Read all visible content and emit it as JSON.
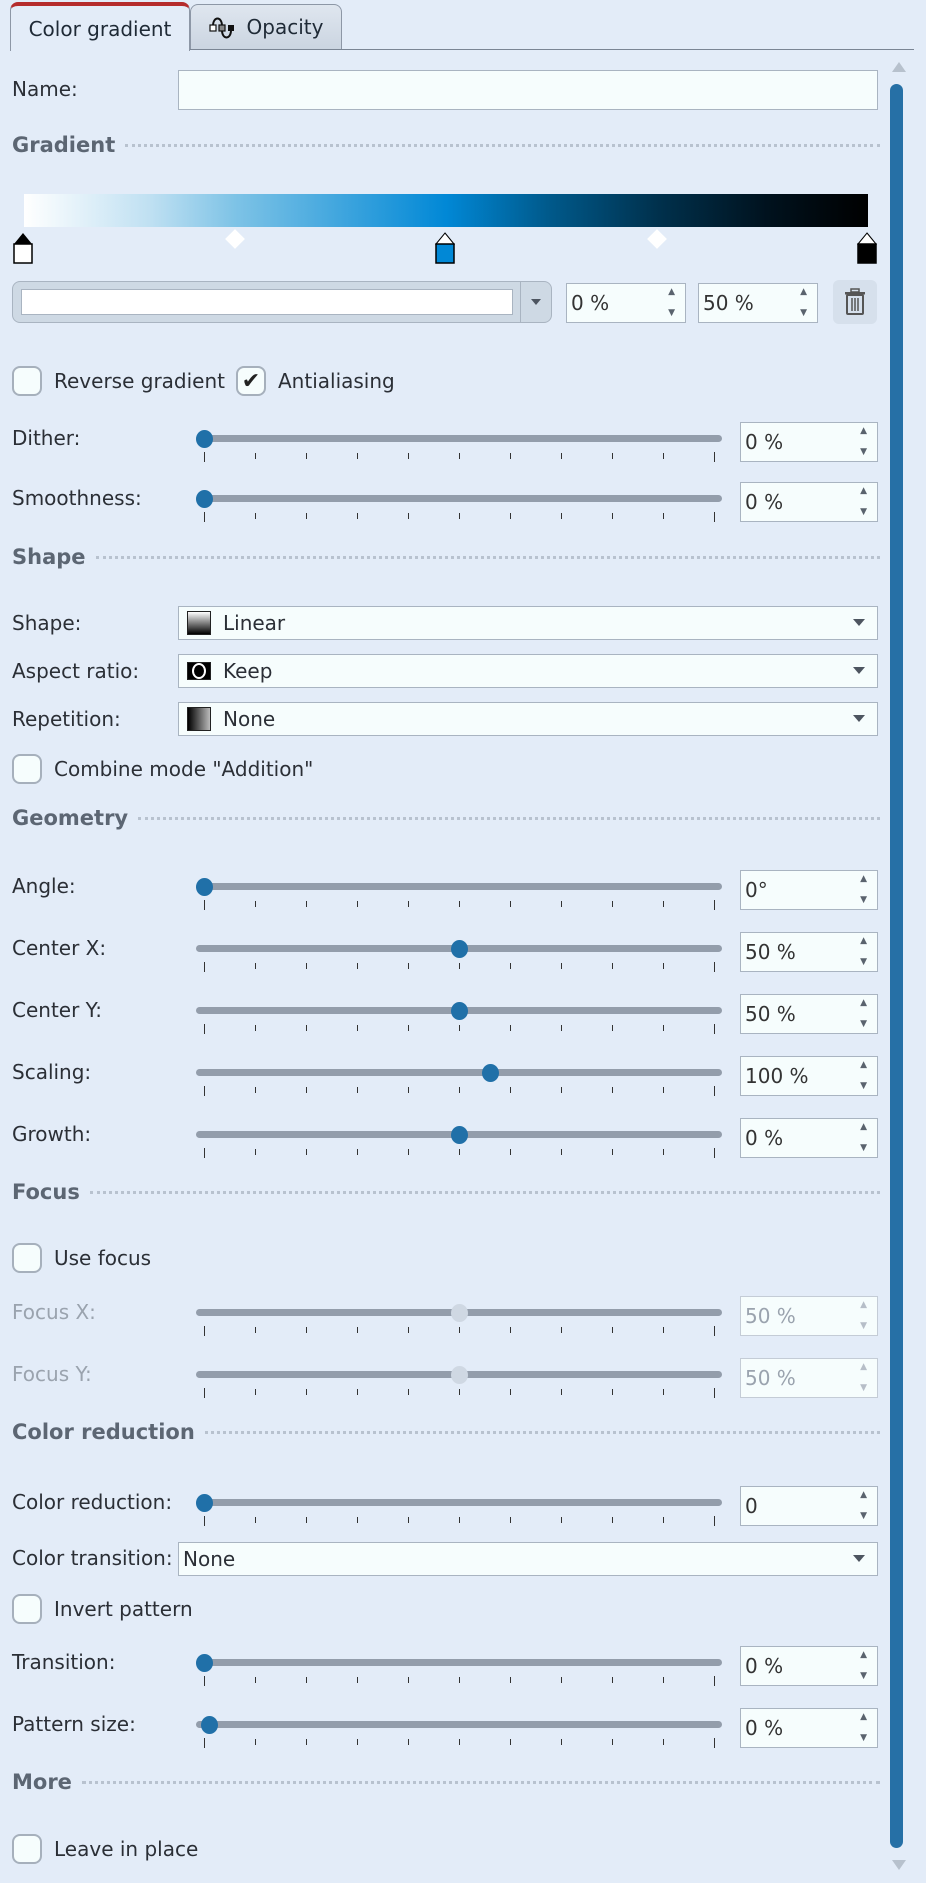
{
  "tabs": [
    {
      "label": "Color gradient",
      "active": true
    },
    {
      "label": "Opacity",
      "icon": "opacity-curve-icon",
      "active": false
    }
  ],
  "name": {
    "label": "Name:",
    "value": ""
  },
  "sections": {
    "gradient": "Gradient",
    "shape": "Shape",
    "geometry": "Geometry",
    "focus": "Focus",
    "color_reduction": "Color reduction",
    "more": "More"
  },
  "gradient": {
    "colors": {
      "start": "#ffffff",
      "mid": "#0188d6",
      "end": "#000000"
    },
    "stops": [
      {
        "position_percent": 0,
        "color": "#ffffff",
        "selected": true
      },
      {
        "position_percent": 50,
        "color": "#0188d6",
        "selected": false
      },
      {
        "position_percent": 100,
        "color": "#000000",
        "selected": false
      }
    ],
    "midpoints_percent": [
      25,
      75
    ],
    "selected_color": "#ffffff",
    "position_value": "0 %",
    "opacity_value": "50 %"
  },
  "checkboxes": {
    "reverse_gradient": {
      "label": "Reverse gradient",
      "checked": false
    },
    "antialiasing": {
      "label": "Antialiasing",
      "checked": true
    },
    "combine_addition": {
      "label": "Combine mode \"Addition\"",
      "checked": false
    },
    "use_focus": {
      "label": "Use focus",
      "checked": false
    },
    "invert_pattern": {
      "label": "Invert pattern",
      "checked": false
    },
    "leave_in_place": {
      "label": "Leave in place",
      "checked": false
    }
  },
  "sliders": {
    "dither": {
      "label": "Dither:",
      "value": "0 %",
      "fraction": 0.0
    },
    "smoothness": {
      "label": "Smoothness:",
      "value": "0 %",
      "fraction": 0.0
    },
    "angle": {
      "label": "Angle:",
      "value": "0°",
      "fraction": 0.0
    },
    "center_x": {
      "label": "Center X:",
      "value": "50 %",
      "fraction": 0.5
    },
    "center_y": {
      "label": "Center Y:",
      "value": "50 %",
      "fraction": 0.5
    },
    "scaling": {
      "label": "Scaling:",
      "value": "100 %",
      "fraction": 0.56
    },
    "growth": {
      "label": "Growth:",
      "value": "0 %",
      "fraction": 0.5
    },
    "focus_x": {
      "label": "Focus X:",
      "value": "50 %",
      "fraction": 0.5,
      "disabled": true
    },
    "focus_y": {
      "label": "Focus Y:",
      "value": "50 %",
      "fraction": 0.5,
      "disabled": true
    },
    "color_reduction": {
      "label": "Color reduction:",
      "value": "0",
      "fraction": 0.0
    },
    "transition": {
      "label": "Transition:",
      "value": "0 %",
      "fraction": 0.0
    },
    "pattern_size": {
      "label": "Pattern size:",
      "value": "0 %",
      "fraction": 0.01
    }
  },
  "dropdowns": {
    "shape": {
      "label": "Shape:",
      "value": "Linear",
      "icon": "linear-gradient-icon"
    },
    "aspect_ratio": {
      "label": "Aspect ratio:",
      "value": "Keep",
      "icon": "keep-aspect-icon"
    },
    "repetition": {
      "label": "Repetition:",
      "value": "None",
      "icon": "no-repetition-icon"
    },
    "color_transition": {
      "label": "Color transition:",
      "value": "None"
    }
  },
  "accent": "#2070a8"
}
